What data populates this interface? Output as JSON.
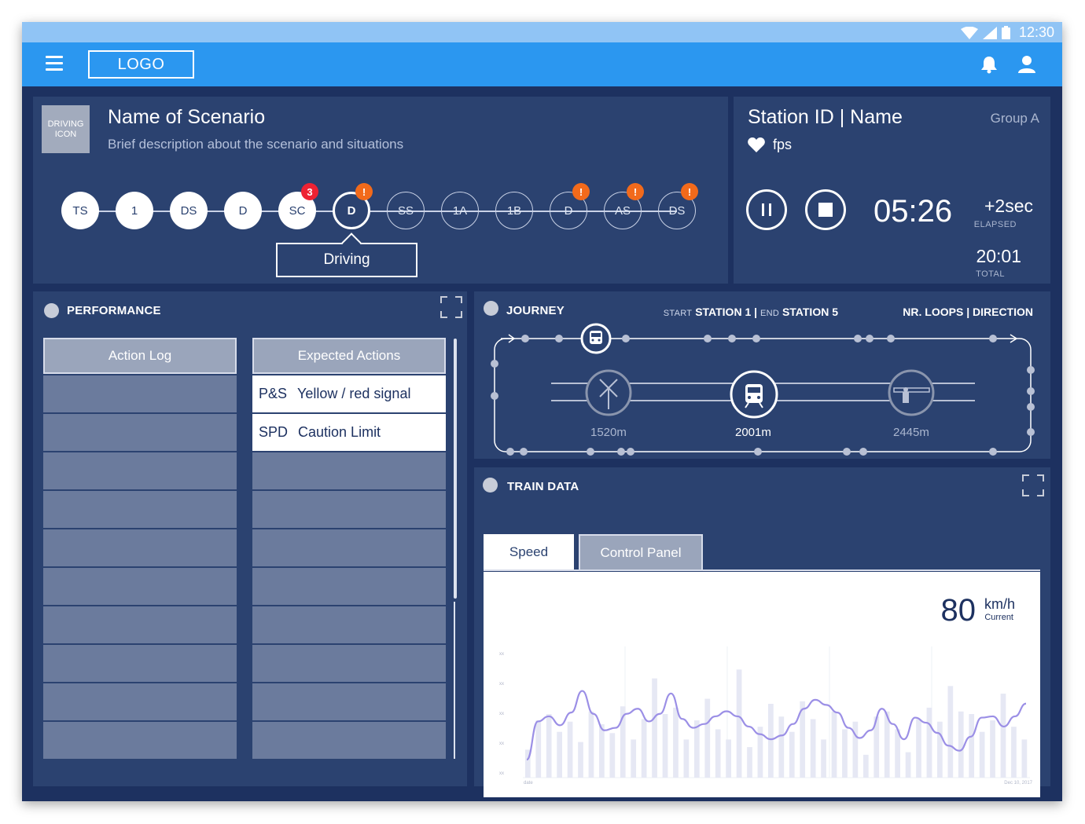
{
  "status_bar": {
    "time": "12:30"
  },
  "header": {
    "logo": "LOGO"
  },
  "scenario": {
    "icon_label": "DRIVING ICON",
    "title": "Name of Scenario",
    "description": "Brief description about the scenario and situations",
    "steps": [
      {
        "label": "TS",
        "state": "done",
        "badge": ""
      },
      {
        "label": "1",
        "state": "done",
        "badge": ""
      },
      {
        "label": "DS",
        "state": "done",
        "badge": ""
      },
      {
        "label": "D",
        "state": "done",
        "badge": ""
      },
      {
        "label": "SC",
        "state": "done",
        "badge": "3",
        "badge_type": "red"
      },
      {
        "label": "D",
        "state": "current",
        "badge": "!",
        "badge_type": "orange"
      },
      {
        "label": "SS",
        "state": "todo",
        "badge": ""
      },
      {
        "label": "1A",
        "state": "todo",
        "badge": ""
      },
      {
        "label": "1B",
        "state": "todo",
        "badge": ""
      },
      {
        "label": "D",
        "state": "todo",
        "badge": "!",
        "badge_type": "orange"
      },
      {
        "label": "AS",
        "state": "todo",
        "badge": "!",
        "badge_type": "orange"
      },
      {
        "label": "DS",
        "state": "todo",
        "badge": "!",
        "badge_type": "orange"
      }
    ],
    "current_tooltip": "Driving"
  },
  "station": {
    "title": "Station ID | Name",
    "group": "Group A",
    "fps_label": "fps",
    "elapsed_time": "05:26",
    "delta": "+2sec",
    "elapsed_label": "ELAPSED",
    "total_time": "20:01",
    "total_label": "TOTAL"
  },
  "performance": {
    "title": "PERFORMANCE",
    "action_log_header": "Action Log",
    "expected_header": "Expected Actions",
    "expected_actions": [
      {
        "code": "P&S",
        "text": "Yellow / red signal"
      },
      {
        "code": "SPD",
        "text": "Caution Limit"
      }
    ],
    "empty_rows": 10
  },
  "journey": {
    "title": "JOURNEY",
    "start_label": "START",
    "start_station": "STATION 1 |",
    "end_label": "END",
    "end_station": "STATION 5",
    "loops_direction": "NR. LOOPS  | DIRECTION",
    "markers": [
      {
        "distance": "1520m",
        "icon": "crossing-icon",
        "active": false
      },
      {
        "distance": "2001m",
        "icon": "train-icon",
        "active": true
      },
      {
        "distance": "2445m",
        "icon": "barrier-icon",
        "active": false
      }
    ]
  },
  "train_data": {
    "title": "TRAIN DATA",
    "tabs": [
      "Speed",
      "Control Panel"
    ],
    "active_tab": "Speed",
    "speed_value": "80",
    "speed_unit": "km/h",
    "speed_label": "Current",
    "colors": {
      "line": "#9b8fe6",
      "bars": "#e6e8f4"
    },
    "chart_data": {
      "type": "line",
      "y_tick_labels": [
        "xx",
        "xx",
        "xx",
        "xx",
        "xx"
      ],
      "x_start_label": "date",
      "x_end_label": "Dec 10, 2017",
      "line_values": [
        0.08,
        0.38,
        0.42,
        0.35,
        0.45,
        0.62,
        0.44,
        0.31,
        0.33,
        0.44,
        0.48,
        0.38,
        0.44,
        0.6,
        0.4,
        0.33,
        0.36,
        0.42,
        0.46,
        0.42,
        0.34,
        0.28,
        0.24,
        0.27,
        0.36,
        0.48,
        0.55,
        0.51,
        0.45,
        0.33,
        0.25,
        0.31,
        0.48,
        0.36,
        0.24,
        0.41,
        0.37,
        0.29,
        0.19,
        0.15,
        0.26,
        0.41,
        0.42,
        0.34,
        0.42,
        0.52
      ],
      "bar_values": [
        0.22,
        0.45,
        0.5,
        0.36,
        0.44,
        0.28,
        0.52,
        0.42,
        0.35,
        0.56,
        0.3,
        0.46,
        0.78,
        0.5,
        0.55,
        0.3,
        0.45,
        0.62,
        0.38,
        0.3,
        0.85,
        0.24,
        0.4,
        0.58,
        0.48,
        0.36,
        0.6,
        0.46,
        0.3,
        0.52,
        0.38,
        0.44,
        0.18,
        0.48,
        0.52,
        0.38,
        0.2,
        0.46,
        0.55,
        0.44,
        0.72,
        0.52,
        0.5,
        0.36,
        0.45,
        0.66,
        0.4,
        0.3
      ]
    }
  }
}
